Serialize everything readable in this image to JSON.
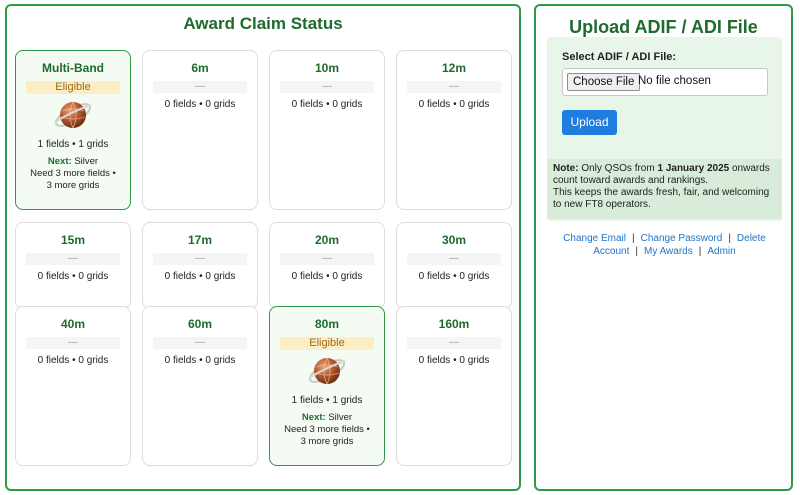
{
  "awards": {
    "title": "Award Claim Status",
    "cards": [
      {
        "band": "Multi-Band",
        "status": "Eligible",
        "eligible": true,
        "counts": "1 fields • 1 grids",
        "next_label": "Next:",
        "next_value": "Silver",
        "need_line1": "Need 3 more fields •",
        "need_line2": "3 more grids"
      },
      {
        "band": "6m",
        "status": "—",
        "eligible": false,
        "counts": "0 fields • 0 grids"
      },
      {
        "band": "10m",
        "status": "—",
        "eligible": false,
        "counts": "0 fields • 0 grids"
      },
      {
        "band": "12m",
        "status": "—",
        "eligible": false,
        "counts": "0 fields • 0 grids"
      },
      {
        "band": "15m",
        "status": "—",
        "eligible": false,
        "counts": "0 fields • 0 grids"
      },
      {
        "band": "17m",
        "status": "—",
        "eligible": false,
        "counts": "0 fields • 0 grids"
      },
      {
        "band": "20m",
        "status": "—",
        "eligible": false,
        "counts": "0 fields • 0 grids"
      },
      {
        "band": "30m",
        "status": "—",
        "eligible": false,
        "counts": "0 fields • 0 grids"
      },
      {
        "band": "40m",
        "status": "—",
        "eligible": false,
        "counts": "0 fields • 0 grids"
      },
      {
        "band": "60m",
        "status": "—",
        "eligible": false,
        "counts": "0 fields • 0 grids"
      },
      {
        "band": "80m",
        "status": "Eligible",
        "eligible": true,
        "counts": "1 fields • 1 grids",
        "next_label": "Next:",
        "next_value": "Silver",
        "need_line1": "Need 3 more fields •",
        "need_line2": "3 more grids"
      },
      {
        "band": "160m",
        "status": "—",
        "eligible": false,
        "counts": "0 fields • 0 grids"
      }
    ]
  },
  "upload": {
    "title": "Upload ADIF / ADI File",
    "select_label": "Select ADIF / ADI File:",
    "choose_file_label": "Choose File",
    "no_file_text": "No file chosen",
    "upload_button": "Upload",
    "note": {
      "label": "Note:",
      "text_before": "Only QSOs from",
      "date": "1 January 2025",
      "text_after": "onwards count toward awards and rankings.",
      "line2": "This keeps the awards fresh, fair, and welcoming to new FT8 operators."
    },
    "links": {
      "change_email": "Change Email",
      "change_password": "Change Password",
      "delete_account": "Delete Account",
      "my_awards": "My Awards",
      "admin": "Admin",
      "separator": "|"
    }
  },
  "colors": {
    "accent_green": "#2e9a44",
    "title_green": "#1f6b2e",
    "eligible_badge": "#fbeec4",
    "upload_button": "#1e7ddf",
    "link_blue": "#1e73c9"
  },
  "icons": {
    "medal": "bronze-globe-medal-icon"
  }
}
